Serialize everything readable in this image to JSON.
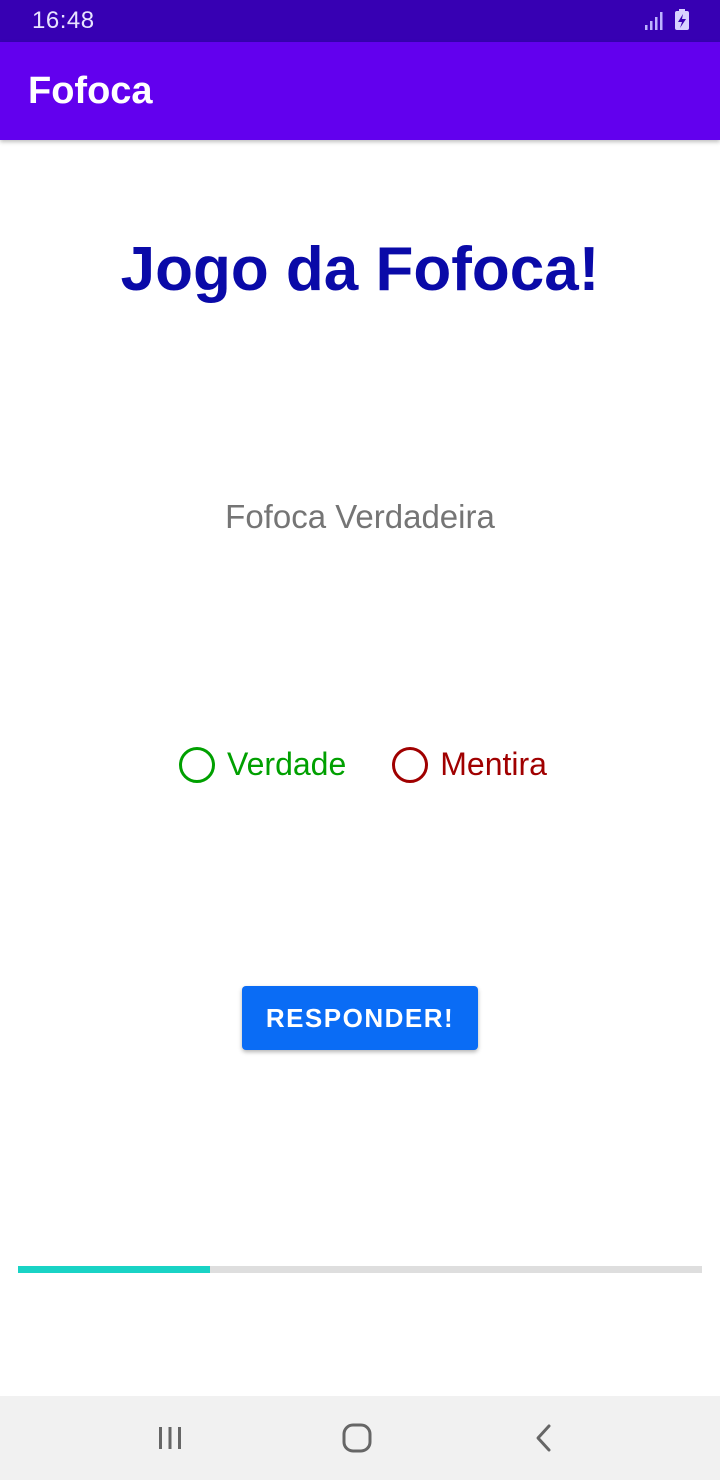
{
  "status_bar": {
    "time": "16:48",
    "icons": [
      "signal-icon",
      "battery-charging-icon"
    ]
  },
  "app_bar": {
    "title": "Fofoca",
    "background_color": "#6200ee"
  },
  "game": {
    "title": "Jogo da Fofoca!",
    "statement": "Fofoca Verdadeira",
    "options": [
      {
        "label": "Verdade",
        "color": "#00a000",
        "selected": false
      },
      {
        "label": "Mentira",
        "color": "#a00000",
        "selected": false
      }
    ],
    "submit_label": "RESPONDER!",
    "progress": 0.28,
    "progress_color": "#19d3c5"
  },
  "nav_bar": {
    "icons": [
      "recent-apps-icon",
      "home-icon",
      "back-icon"
    ]
  }
}
